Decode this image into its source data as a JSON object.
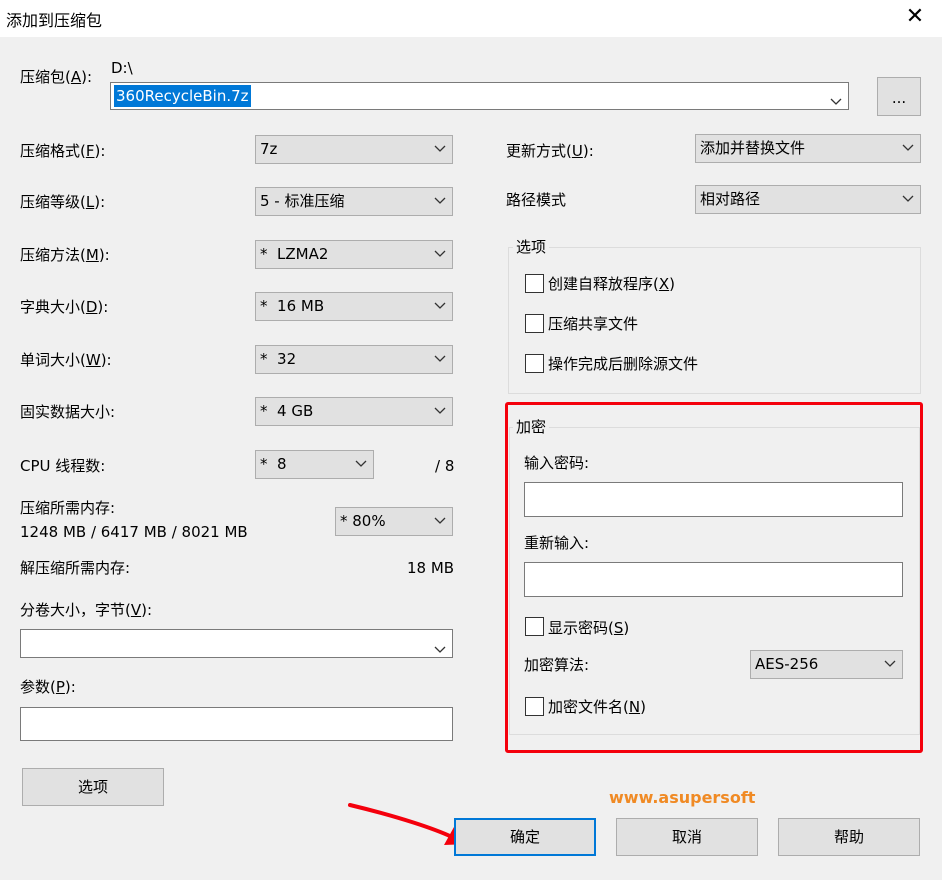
{
  "window": {
    "title": "添加到压缩包",
    "close_glyph": "✕"
  },
  "archive": {
    "label": "压缩包(A):",
    "path": "D:\\",
    "filename": "360RecycleBin.7z",
    "browse_label": "..."
  },
  "left": {
    "format": {
      "label": "压缩格式(F):",
      "value": "7z"
    },
    "level": {
      "label": "压缩等级(L):",
      "value": "5 - 标准压缩"
    },
    "method": {
      "label": "压缩方法(M):",
      "value": "*  LZMA2"
    },
    "dict": {
      "label": "字典大小(D):",
      "value": "*  16 MB"
    },
    "word": {
      "label": "单词大小(W):",
      "value": "*  32"
    },
    "solid": {
      "label": "固实数据大小:",
      "value": "*  4 GB"
    },
    "threads": {
      "label": "CPU 线程数:",
      "value": "*  8",
      "max": "/ 8"
    },
    "memory": {
      "label": "压缩所需内存:",
      "detail": "1248 MB / 6417 MB / 8021 MB",
      "value": "* 80%"
    },
    "decompress_memory": {
      "label": "解压缩所需内存:",
      "value": "18 MB"
    },
    "volume": {
      "label": "分卷大小，字节(V):",
      "value": ""
    },
    "params": {
      "label": "参数(P):",
      "value": ""
    },
    "options_button": "选项"
  },
  "right": {
    "update": {
      "label": "更新方式(U):",
      "value": "添加并替换文件"
    },
    "path_mode": {
      "label": "路径模式",
      "value": "相对路径"
    },
    "options_group": {
      "title": "选项",
      "sfx": "创建自释放程序(X)",
      "shared": "压缩共享文件",
      "delete_after": "操作完成后删除源文件"
    },
    "encryption": {
      "title": "加密",
      "password_label": "输入密码:",
      "reenter_label": "重新输入:",
      "show_password": "显示密码(S)",
      "method_label": "加密算法:",
      "method_value": "AES-256",
      "encrypt_names": "加密文件名(N)"
    }
  },
  "buttons": {
    "ok": "确定",
    "cancel": "取消",
    "help": "帮助"
  },
  "watermark": "www.asupersoft",
  "colors": {
    "highlight_box": "#f4000c",
    "watermark": "#f08a24",
    "selection": "#0078d7"
  }
}
